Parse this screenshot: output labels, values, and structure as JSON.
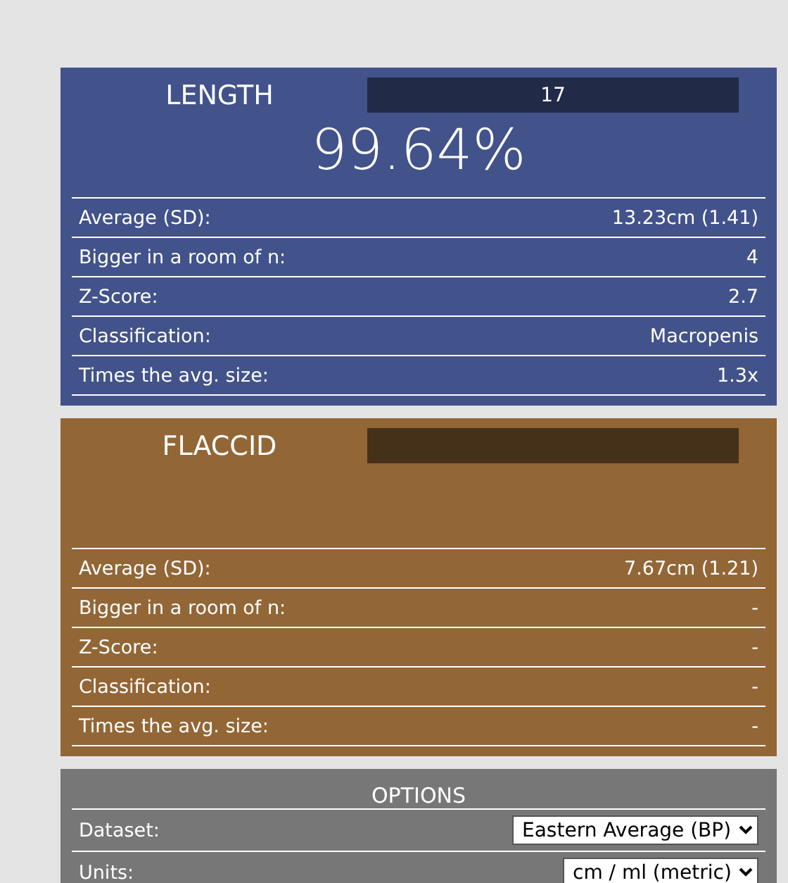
{
  "panels": [
    {
      "kind": "length",
      "title": "LENGTH",
      "input": {
        "value": "17"
      },
      "percentile": "99.64%",
      "rows": [
        {
          "label": "Average (SD):",
          "value": "13.23cm (1.41)"
        },
        {
          "label": "Bigger in a room of n:",
          "value": "4"
        },
        {
          "label": "Z-Score:",
          "value": "2.7"
        },
        {
          "label": "Classification:",
          "value": "Macropenis"
        },
        {
          "label": "Times the avg. size:",
          "value": "1.3x"
        }
      ]
    },
    {
      "kind": "flaccid",
      "title": "FLACCID",
      "rows": [
        {
          "label": "Average (SD):",
          "value": "7.67cm (1.21)"
        },
        {
          "label": "Bigger in a room of n:",
          "value": "-"
        },
        {
          "label": "Z-Score:",
          "value": "-"
        },
        {
          "label": "Classification:",
          "value": "-"
        },
        {
          "label": "Times the avg. size:",
          "value": "-"
        }
      ]
    }
  ],
  "options": {
    "title": "OPTIONS",
    "rows": [
      {
        "label": "Dataset:",
        "value": "Eastern Average (BP)"
      },
      {
        "label": "Units:",
        "value": "cm / ml (metric)"
      }
    ]
  }
}
